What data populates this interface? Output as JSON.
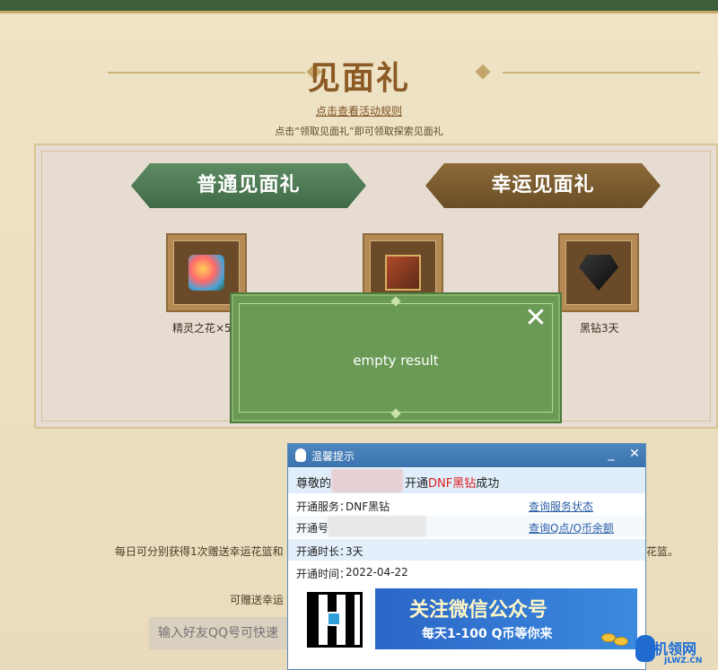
{
  "header": {
    "title": "见面礼",
    "rules_link": "点击查看活动规则",
    "hint": "点击“领取见面礼”即可领取探索见面礼"
  },
  "tabs": {
    "normal": "普通见面礼",
    "lucky": "幸运见面礼"
  },
  "items": [
    {
      "label": "精灵之花×5",
      "icon": "flower-icon"
    },
    {
      "label": "",
      "icon": "chest-icon"
    },
    {
      "label": "黑钻3天",
      "icon": "black-diamond-icon"
    }
  ],
  "lower": {
    "daily_text_left": "每日可分别获得1次赠送幸运花篮和",
    "daily_text_right": "花篮。",
    "invite_label": "可赠送幸运",
    "qq_input_placeholder": "输入好友QQ号可快速"
  },
  "modal": {
    "message": "empty result",
    "close": "✕"
  },
  "qq_window": {
    "title": "温馨提示",
    "minimize": "_",
    "close": "✕",
    "message_prefix": "尊敬的",
    "message_mid": "开通",
    "message_product": "DNF黑钻",
    "message_suffix": "成功",
    "rows": [
      {
        "key": "开通服务：",
        "value": "DNF黑钻",
        "link": "查询服务状态"
      },
      {
        "key": "开通号",
        "value": "",
        "link": "查询Q点/Q币余额"
      },
      {
        "key": "开通时长：",
        "value": "3天",
        "link": ""
      },
      {
        "key": "开通时间：",
        "value": "2022-04-22",
        "link": ""
      }
    ],
    "banner_line1": "关注微信公众号",
    "banner_line2": "每天1-100 Q币等你来"
  },
  "watermark": {
    "text": "机领网",
    "sub": "JLWZ.CN"
  },
  "colors": {
    "brown_title": "#8b5a25",
    "modal_green": "#6b9a56",
    "qq_blue": "#3a72ad",
    "accent_red": "#e02020"
  }
}
